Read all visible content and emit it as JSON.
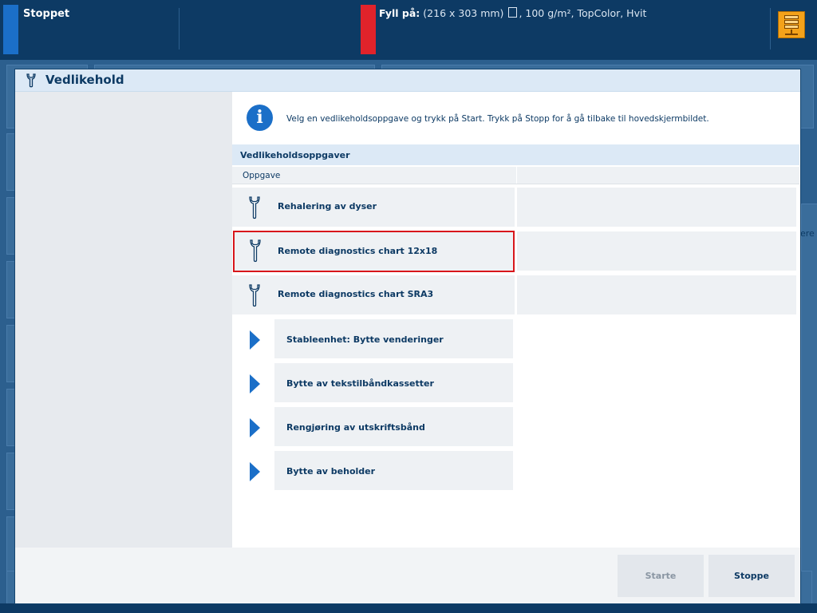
{
  "topbar": {
    "status": "Stoppet",
    "fill_label": "Fyll på:",
    "fill_size": "(216 x 303 mm)",
    "fill_details": ", 100 g/m², TopColor, Hvit",
    "server_icon": "server-stack-icon"
  },
  "dialog": {
    "title": "Vedlikehold",
    "title_icon": "wrench-icon",
    "info_icon": "info-icon",
    "info_text": "Velg en vedlikeholdsoppgave og trykk på Start. Trykk på Stopp for å gå tilbake til hovedskjermbildet.",
    "section_title": "Vedlikeholdsoppgaver",
    "column_header": "Oppgave",
    "tasks": [
      {
        "label": "Rehalering av dyser",
        "icon": "wrench-icon"
      },
      {
        "label": "Remote diagnostics chart 12x18",
        "icon": "wrench-icon",
        "selected": true
      },
      {
        "label": "Remote diagnostics chart SRA3",
        "icon": "wrench-icon"
      }
    ],
    "groups": [
      {
        "label": "Stableenhet: Bytte venderinger",
        "icon": "expand-arrow-icon"
      },
      {
        "label": "Bytte av tekstilbåndkassetter",
        "icon": "expand-arrow-icon"
      },
      {
        "label": "Rengjøring av utskriftsbånd",
        "icon": "expand-arrow-icon"
      },
      {
        "label": "Bytte av beholder",
        "icon": "expand-arrow-icon"
      }
    ],
    "buttons": {
      "start": "Starte",
      "stop": "Stoppe"
    }
  },
  "background": {
    "fragment": "ere"
  },
  "colors": {
    "navy": "#0d3a64",
    "accent_blue": "#1b6fc8",
    "alert_red": "#e0232b",
    "selection_red": "#d8161b",
    "server_orange": "#f4a21a"
  }
}
